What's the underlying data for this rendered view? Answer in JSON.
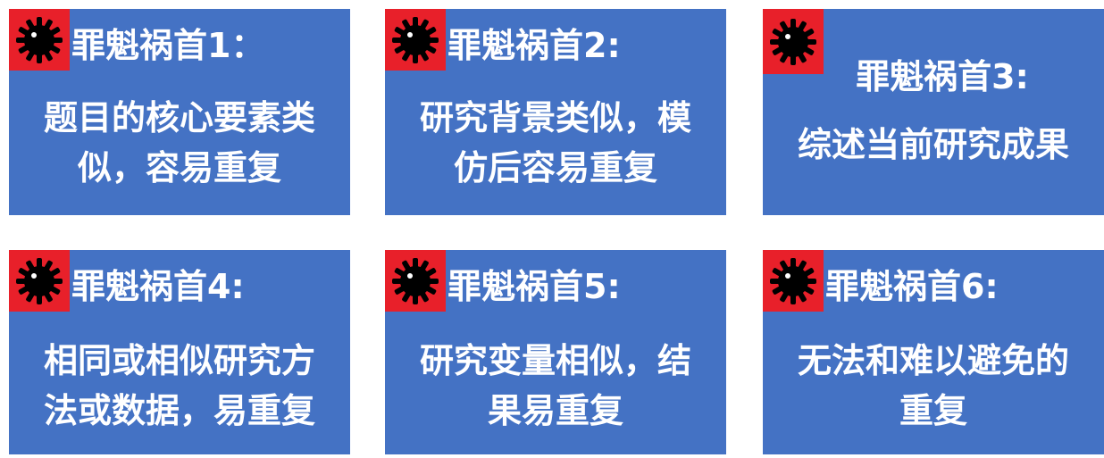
{
  "cards": [
    {
      "title": "罪魁祸首1：",
      "line1": "题目的核心要素类",
      "line2": "似，容易重复"
    },
    {
      "title": "罪魁祸首2:",
      "line1": "研究背景类似，模",
      "line2": "仿后容易重复"
    },
    {
      "title": "罪魁祸首3:",
      "line1": "综述当前研究成果",
      "line2": ""
    },
    {
      "title": "罪魁祸首4:",
      "line1": "相同或相似研究方",
      "line2": "法或数据，易重复"
    },
    {
      "title": "罪魁祸首5:",
      "line1": "研究变量相似，结",
      "line2": "果易重复"
    },
    {
      "title": "罪魁祸首6:",
      "line1": "无法和难以避免的",
      "line2": "重复"
    }
  ],
  "colors": {
    "card_bg": "#4472c4",
    "badge_bg": "#e8202a",
    "text": "#ffffff"
  },
  "icon": "virus-icon"
}
